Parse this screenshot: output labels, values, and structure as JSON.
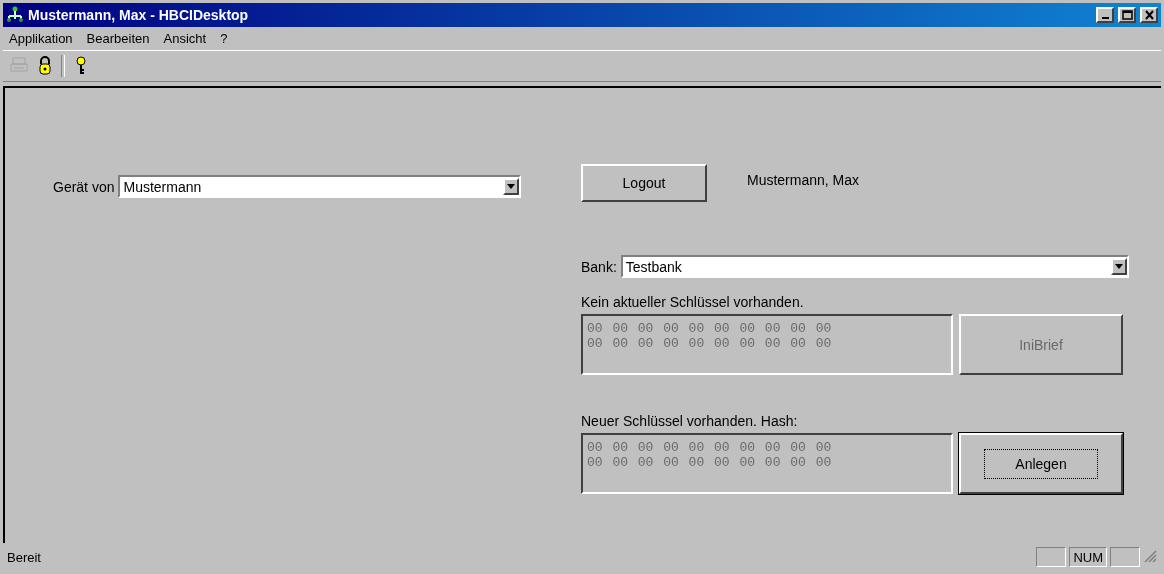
{
  "window": {
    "title": "Mustermann, Max - HBCIDesktop"
  },
  "menu": [
    {
      "label": "Applikation"
    },
    {
      "label": "Bearbeiten"
    },
    {
      "label": "Ansicht"
    },
    {
      "label": "?"
    }
  ],
  "toolbar": [
    {
      "kind": "print",
      "disabled": true
    },
    {
      "kind": "lock",
      "disabled": false
    },
    {
      "kind": "help",
      "disabled": false
    }
  ],
  "device": {
    "label": "Gerät von",
    "value": "Mustermann"
  },
  "logout_button": {
    "label": "Logout"
  },
  "user_name": "Mustermann, Max",
  "bank": {
    "label": "Bank:",
    "value": "Testbank"
  },
  "key_sections": [
    {
      "caption": "Kein aktueller Schlüssel vorhanden.",
      "disabled": true,
      "lines": [
        "00 00 00 00 00 00 00 00 00 00",
        "00 00 00 00 00 00 00 00 00 00"
      ],
      "button": {
        "label": "IniBrief",
        "disabled": true,
        "default": false
      }
    },
    {
      "caption": "Neuer Schlüssel vorhanden. Hash:",
      "disabled": true,
      "lines": [
        "00 00 00 00 00 00 00 00 00 00",
        "00 00 00 00 00 00 00 00 00 00"
      ],
      "button": {
        "label": "Anlegen",
        "disabled": false,
        "default": true
      }
    }
  ],
  "status_bar": {
    "text": "Bereit",
    "indicators": [
      {
        "kind": "blank"
      },
      {
        "kind": "text",
        "text": "NUM"
      },
      {
        "kind": "blank"
      }
    ]
  }
}
